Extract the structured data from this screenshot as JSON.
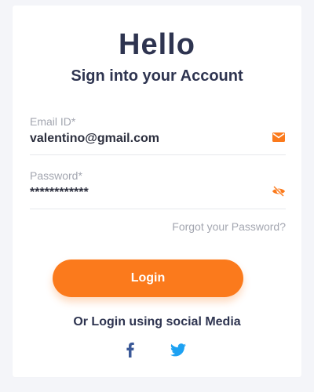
{
  "colors": {
    "page_background": "#f4f5f9",
    "card_background": "#ffffff",
    "heading": "#2e3450",
    "label": "#a3a6b0",
    "value": "#2c2f3e",
    "accent": "#fb7a1c",
    "facebook": "#3b5998",
    "twitter": "#1da1f2"
  },
  "header": {
    "title": "Hello",
    "subtitle": "Sign into your Account"
  },
  "form": {
    "email": {
      "label": "Email ID*",
      "value": "valentino@gmail.com",
      "icon": "envelope-icon"
    },
    "password": {
      "label": "Password*",
      "value": "************",
      "icon": "eye-slash-icon"
    },
    "forgot_label": "Forgot your Password?",
    "login_label": "Login"
  },
  "social": {
    "text": "Or Login using social Media",
    "items": [
      {
        "name": "facebook",
        "icon": "facebook-icon"
      },
      {
        "name": "twitter",
        "icon": "twitter-icon"
      }
    ]
  }
}
